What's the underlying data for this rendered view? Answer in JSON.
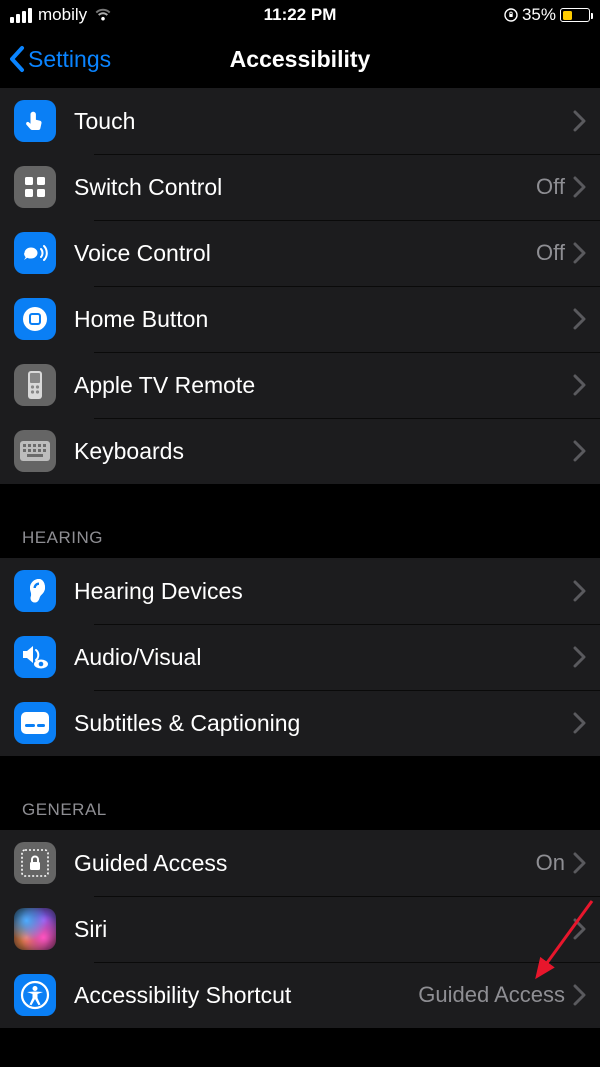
{
  "status": {
    "carrier": "mobily",
    "time": "11:22 PM",
    "battery_percent": "35%"
  },
  "nav": {
    "back_label": "Settings",
    "title": "Accessibility"
  },
  "colors": {
    "link": "#0a84ff",
    "section_bg": "#1c1c1e",
    "secondary_text": "#8e8e93"
  },
  "groups": [
    {
      "header": null,
      "rows": [
        {
          "id": "touch",
          "icon": "touch-icon",
          "icon_bg": "blue",
          "label": "Touch",
          "value": null
        },
        {
          "id": "switch-control",
          "icon": "grid-icon",
          "icon_bg": "gray",
          "label": "Switch Control",
          "value": "Off"
        },
        {
          "id": "voice-control",
          "icon": "voice-icon",
          "icon_bg": "blue",
          "label": "Voice Control",
          "value": "Off"
        },
        {
          "id": "home-button",
          "icon": "home-button-icon",
          "icon_bg": "blue",
          "label": "Home Button",
          "value": null
        },
        {
          "id": "apple-tv-remote",
          "icon": "remote-icon",
          "icon_bg": "gray",
          "label": "Apple TV Remote",
          "value": null
        },
        {
          "id": "keyboards",
          "icon": "keyboard-icon",
          "icon_bg": "gray",
          "label": "Keyboards",
          "value": null
        }
      ]
    },
    {
      "header": "HEARING",
      "rows": [
        {
          "id": "hearing-devices",
          "icon": "ear-icon",
          "icon_bg": "blue",
          "label": "Hearing Devices",
          "value": null
        },
        {
          "id": "audio-visual",
          "icon": "speaker-eye-icon",
          "icon_bg": "blue",
          "label": "Audio/Visual",
          "value": null
        },
        {
          "id": "subtitles",
          "icon": "captions-icon",
          "icon_bg": "blue",
          "label": "Subtitles & Captioning",
          "value": null
        }
      ]
    },
    {
      "header": "GENERAL",
      "rows": [
        {
          "id": "guided-access",
          "icon": "lock-frame-icon",
          "icon_bg": "gray",
          "label": "Guided Access",
          "value": "On"
        },
        {
          "id": "siri",
          "icon": "siri-icon",
          "icon_bg": "siri",
          "label": "Siri",
          "value": null
        },
        {
          "id": "accessibility-shortcut",
          "icon": "accessibility-icon",
          "icon_bg": "blue",
          "label": "Accessibility Shortcut",
          "value": "Guided Access"
        }
      ]
    }
  ]
}
